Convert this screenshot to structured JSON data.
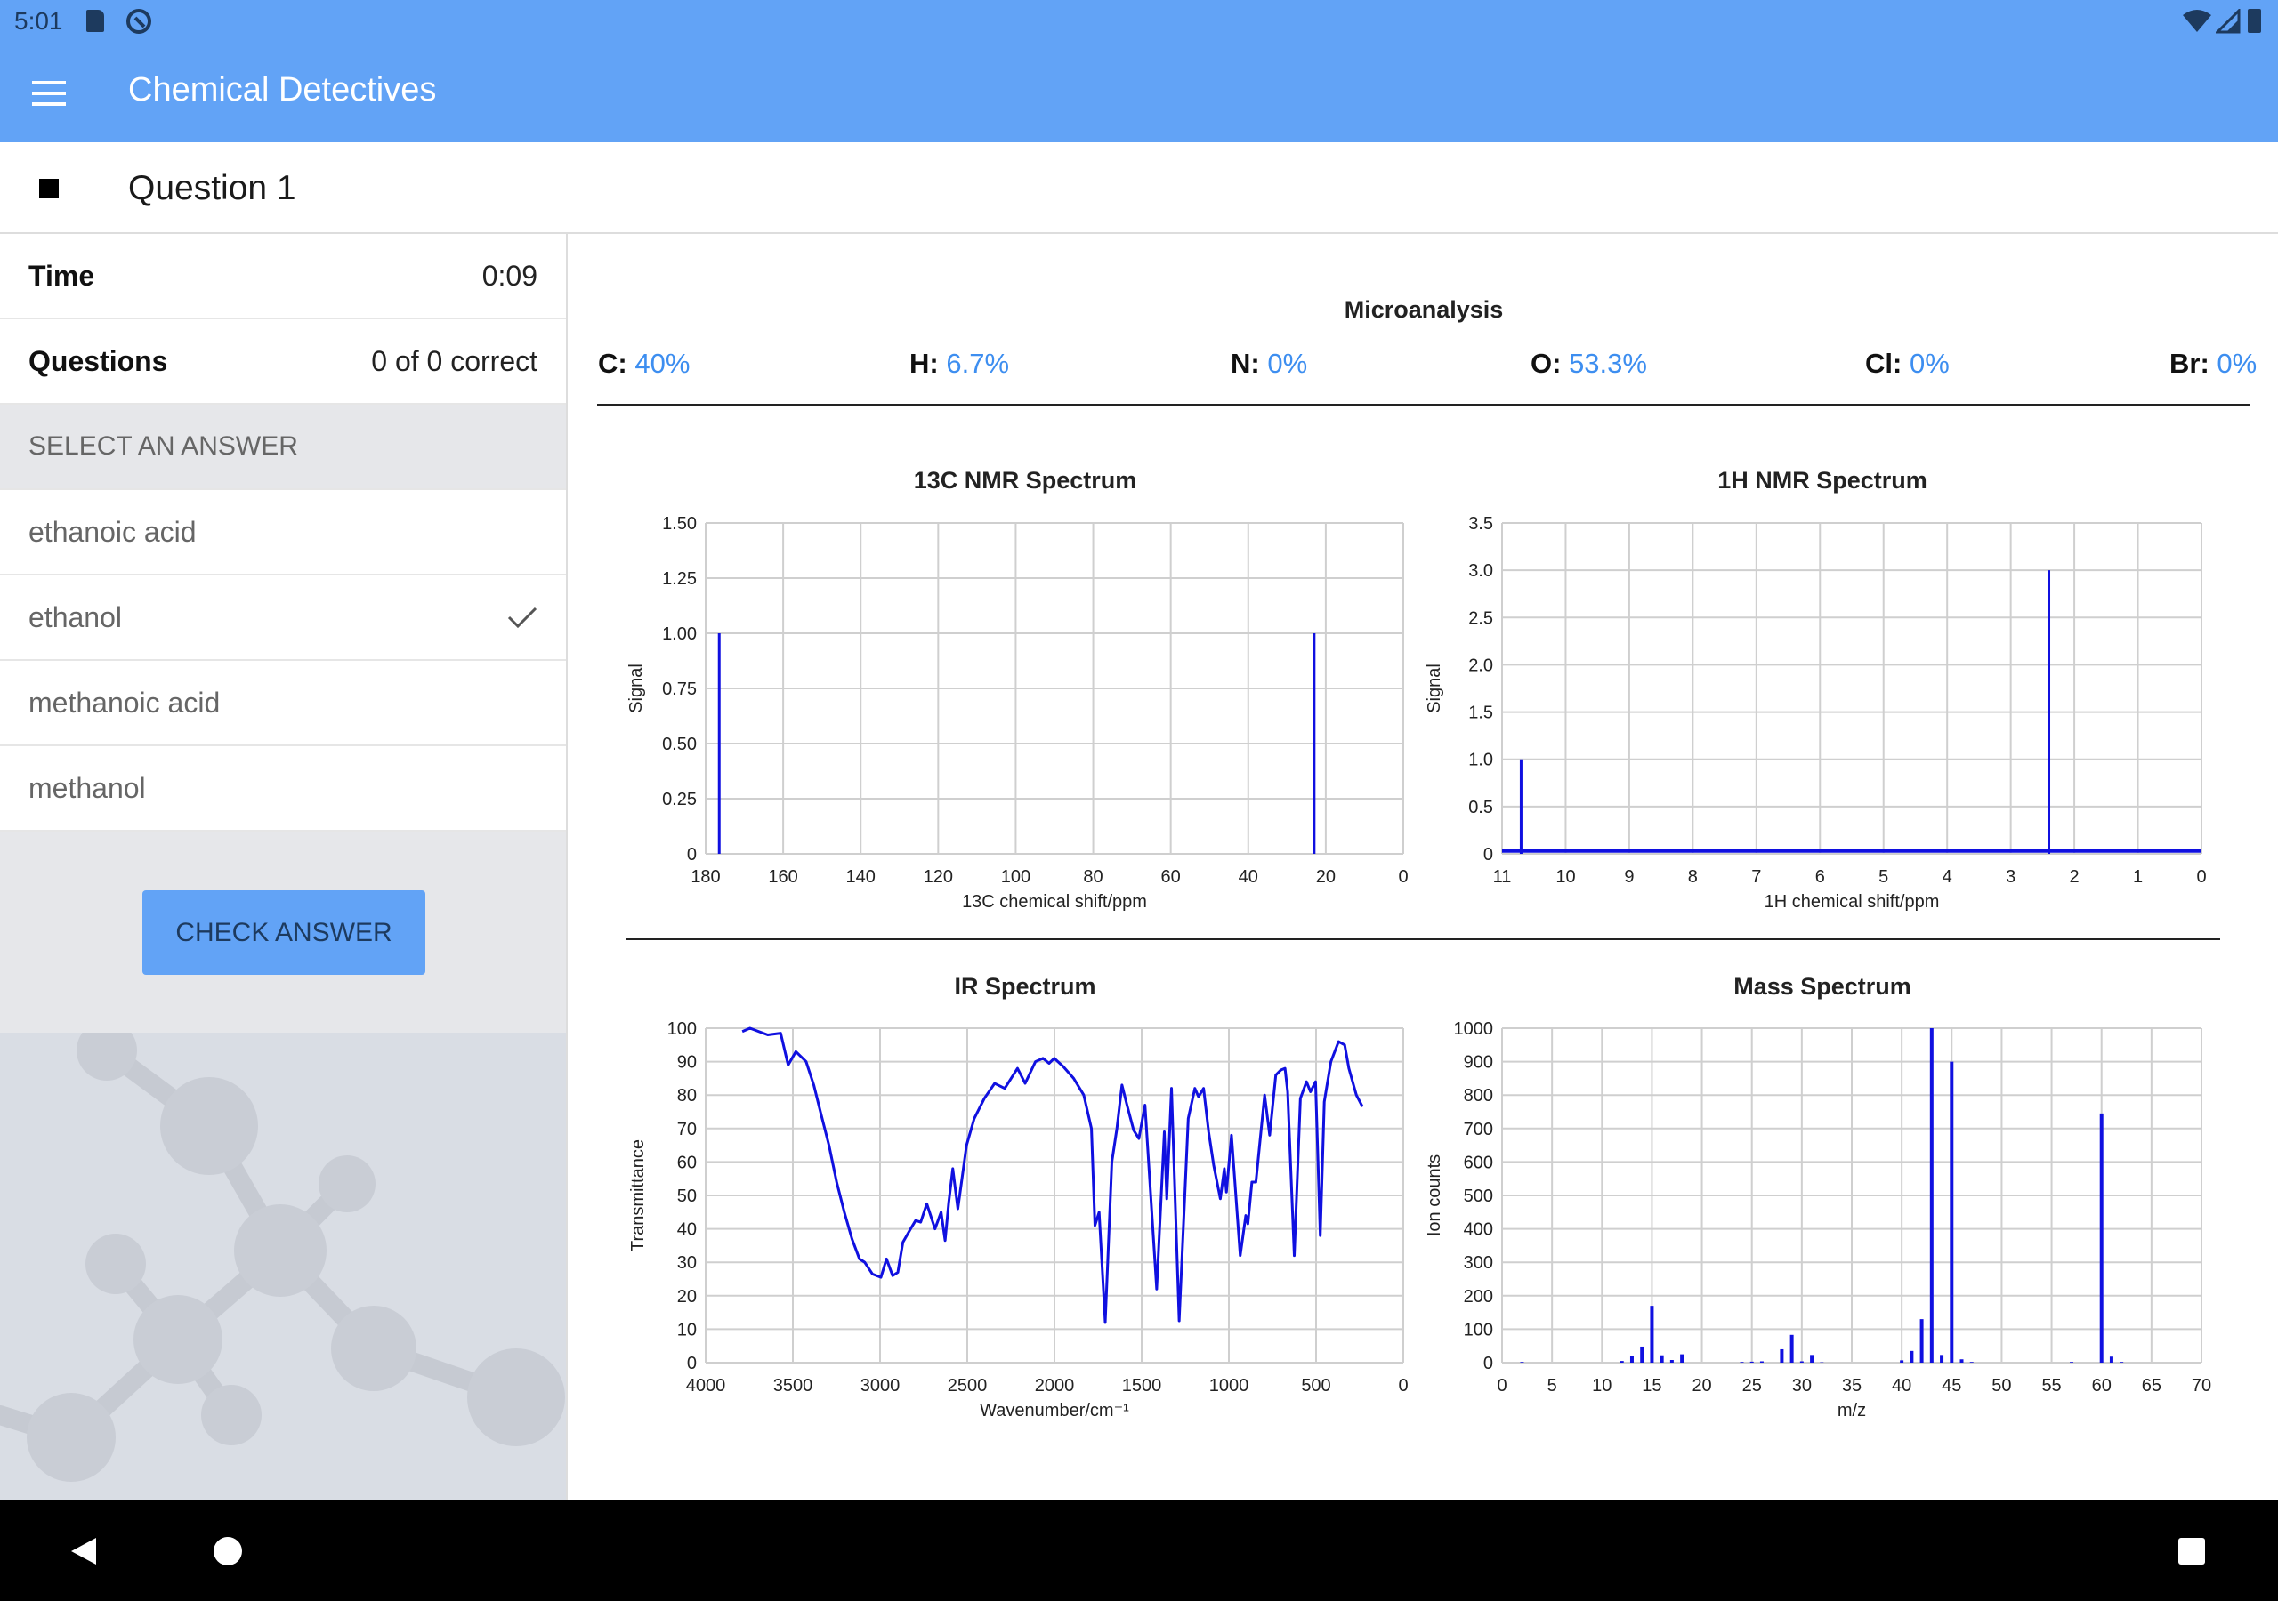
{
  "status_bar": {
    "time": "5:01",
    "icons": [
      "sd-card-icon",
      "sync-icon",
      "wifi-icon",
      "signal-icon",
      "battery-icon"
    ]
  },
  "app_bar": {
    "title": "Chemical Detectives",
    "menu_icon": "hamburger-menu-icon"
  },
  "question_header": {
    "title": "Question 1",
    "icon": "stop-square-icon"
  },
  "sidebar": {
    "time_label": "Time",
    "time_value": "0:09",
    "questions_label": "Questions",
    "questions_value": "0 of 0 correct",
    "select_header": "SELECT AN ANSWER",
    "options": [
      {
        "label": "ethanoic acid",
        "selected": false
      },
      {
        "label": "ethanol",
        "selected": true
      },
      {
        "label": "methanoic acid",
        "selected": false
      },
      {
        "label": "methanol",
        "selected": false
      }
    ],
    "check_button": "CHECK ANSWER"
  },
  "microanalysis": {
    "title": "Microanalysis",
    "items": [
      {
        "label": "C:",
        "value": "40%"
      },
      {
        "label": "H:",
        "value": "6.7%"
      },
      {
        "label": "N:",
        "value": "0%"
      },
      {
        "label": "O:",
        "value": "53.3%"
      },
      {
        "label": "Cl:",
        "value": "0%"
      },
      {
        "label": "Br:",
        "value": "0%"
      }
    ]
  },
  "colors": {
    "app_bar": "#62a3f6",
    "accent_value": "#3d8ef0",
    "button": "#62a3f6",
    "trace": "#1010e0"
  },
  "chart_data": [
    {
      "id": "c13",
      "type": "bar",
      "title": "13C NMR Spectrum",
      "xlabel": "13C chemical shift/ppm",
      "ylabel": "Signal",
      "xlim": [
        180,
        0
      ],
      "ylim": [
        0,
        1.5
      ],
      "grid": true,
      "xticks": [
        "180",
        "160",
        "140",
        "120",
        "100",
        "80",
        "60",
        "40",
        "20",
        "0"
      ],
      "yticks": [
        "0",
        "0.25",
        "0.50",
        "0.75",
        "1.00",
        "1.25",
        "1.50"
      ],
      "peaks": [
        {
          "x": 176.5,
          "y": 1.0
        },
        {
          "x": 23,
          "y": 1.0
        }
      ]
    },
    {
      "id": "h1",
      "type": "bar",
      "title": "1H NMR Spectrum",
      "xlabel": "1H chemical shift/ppm",
      "ylabel": "Signal",
      "xlim": [
        11,
        0
      ],
      "ylim": [
        0,
        3.5
      ],
      "grid": true,
      "xticks": [
        "11",
        "10",
        "9",
        "8",
        "7",
        "6",
        "5",
        "4",
        "3",
        "2",
        "1",
        "0"
      ],
      "yticks": [
        "0",
        "0.5",
        "1.0",
        "1.5",
        "2.0",
        "2.5",
        "3.0",
        "3.5"
      ],
      "peaks": [
        {
          "x": 10.7,
          "y": 1.0
        },
        {
          "x": 2.4,
          "y": 3.0
        }
      ]
    },
    {
      "id": "ir",
      "type": "line",
      "title": "IR Spectrum",
      "xlabel": "Wavenumber/cm⁻¹",
      "ylabel": "Transmittance",
      "xlim": [
        4000,
        0
      ],
      "ylim": [
        0,
        100
      ],
      "grid": true,
      "xticks": [
        "4000",
        "3500",
        "3000",
        "2500",
        "2000",
        "1500",
        "1000",
        "500",
        "0"
      ],
      "yticks": [
        "0",
        "10",
        "20",
        "30",
        "40",
        "50",
        "60",
        "70",
        "80",
        "90",
        "100"
      ],
      "points": [
        [
          3790,
          99
        ],
        [
          3746,
          100
        ],
        [
          3644,
          98
        ],
        [
          3570,
          98.5
        ],
        [
          3527,
          89
        ],
        [
          3483,
          93
        ],
        [
          3424,
          90
        ],
        [
          3380,
          83
        ],
        [
          3337,
          74
        ],
        [
          3293,
          65
        ],
        [
          3249,
          54
        ],
        [
          3205,
          45
        ],
        [
          3161,
          37
        ],
        [
          3118,
          31
        ],
        [
          3088,
          30
        ],
        [
          3044,
          26.5
        ],
        [
          2995,
          25.5
        ],
        [
          2963,
          31
        ],
        [
          2928,
          26
        ],
        [
          2898,
          27
        ],
        [
          2869,
          36
        ],
        [
          2825,
          40
        ],
        [
          2796,
          42.5
        ],
        [
          2767,
          42
        ],
        [
          2732,
          47.5
        ],
        [
          2685,
          40
        ],
        [
          2650,
          45
        ],
        [
          2627,
          36.5
        ],
        [
          2606,
          48
        ],
        [
          2583,
          58
        ],
        [
          2554,
          46
        ],
        [
          2504,
          65
        ],
        [
          2460,
          73
        ],
        [
          2402,
          79
        ],
        [
          2343,
          83.5
        ],
        [
          2285,
          82
        ],
        [
          2212,
          88
        ],
        [
          2168,
          83.5
        ],
        [
          2109,
          90
        ],
        [
          2066,
          91
        ],
        [
          2031,
          89.5
        ],
        [
          2001,
          91
        ],
        [
          1949,
          88.5
        ],
        [
          1890,
          85
        ],
        [
          1832,
          80
        ],
        [
          1788,
          70
        ],
        [
          1768,
          41
        ],
        [
          1744,
          45
        ],
        [
          1709,
          12
        ],
        [
          1671,
          60
        ],
        [
          1642,
          70
        ],
        [
          1613,
          83
        ],
        [
          1584,
          77
        ],
        [
          1546,
          69.5
        ],
        [
          1516,
          67
        ],
        [
          1481,
          77
        ],
        [
          1414,
          22
        ],
        [
          1370,
          69
        ],
        [
          1356,
          49
        ],
        [
          1329,
          82
        ],
        [
          1285,
          12.5
        ],
        [
          1233,
          73
        ],
        [
          1195,
          82
        ],
        [
          1174,
          79.5
        ],
        [
          1145,
          82
        ],
        [
          1116,
          69
        ],
        [
          1087,
          59
        ],
        [
          1049,
          49
        ],
        [
          1026,
          58
        ],
        [
          1014,
          51
        ],
        [
          985,
          68
        ],
        [
          935,
          32
        ],
        [
          903,
          44
        ],
        [
          891,
          41.5
        ],
        [
          868,
          54
        ],
        [
          845,
          54
        ],
        [
          795,
          80
        ],
        [
          766,
          68
        ],
        [
          731,
          86
        ],
        [
          702,
          87.5
        ],
        [
          678,
          88
        ],
        [
          663,
          81
        ],
        [
          625,
          32
        ],
        [
          590,
          79
        ],
        [
          555,
          84
        ],
        [
          532,
          81
        ],
        [
          503,
          84
        ],
        [
          476,
          38
        ],
        [
          453,
          78
        ],
        [
          415,
          90
        ],
        [
          371,
          96
        ],
        [
          336,
          95
        ],
        [
          312,
          88
        ],
        [
          269,
          80
        ],
        [
          234,
          76.5
        ]
      ]
    },
    {
      "id": "ms",
      "type": "bar",
      "title": "Mass Spectrum",
      "xlabel": "m/z",
      "ylabel": "Ion counts",
      "xlim": [
        0,
        70
      ],
      "ylim": [
        0,
        1000
      ],
      "grid": true,
      "xticks": [
        "0",
        "5",
        "10",
        "15",
        "20",
        "25",
        "30",
        "35",
        "40",
        "45",
        "50",
        "55",
        "60",
        "65",
        "70"
      ],
      "yticks": [
        "0",
        "100",
        "200",
        "300",
        "400",
        "500",
        "600",
        "700",
        "800",
        "900",
        "1000"
      ],
      "peaks": [
        {
          "x": 2,
          "y": 2
        },
        {
          "x": 12,
          "y": 5
        },
        {
          "x": 13,
          "y": 20
        },
        {
          "x": 14,
          "y": 48
        },
        {
          "x": 15,
          "y": 170
        },
        {
          "x": 16,
          "y": 22
        },
        {
          "x": 17,
          "y": 8
        },
        {
          "x": 18,
          "y": 25
        },
        {
          "x": 24,
          "y": 2
        },
        {
          "x": 25,
          "y": 3
        },
        {
          "x": 26,
          "y": 4
        },
        {
          "x": 28,
          "y": 40
        },
        {
          "x": 29,
          "y": 83
        },
        {
          "x": 30,
          "y": 4
        },
        {
          "x": 31,
          "y": 23
        },
        {
          "x": 32,
          "y": 1
        },
        {
          "x": 40,
          "y": 7
        },
        {
          "x": 41,
          "y": 35
        },
        {
          "x": 42,
          "y": 130
        },
        {
          "x": 43,
          "y": 1000
        },
        {
          "x": 44,
          "y": 23
        },
        {
          "x": 45,
          "y": 900
        },
        {
          "x": 46,
          "y": 10
        },
        {
          "x": 47,
          "y": 2
        },
        {
          "x": 57,
          "y": 2
        },
        {
          "x": 60,
          "y": 745
        },
        {
          "x": 61,
          "y": 18
        },
        {
          "x": 62,
          "y": 2
        }
      ]
    }
  ]
}
